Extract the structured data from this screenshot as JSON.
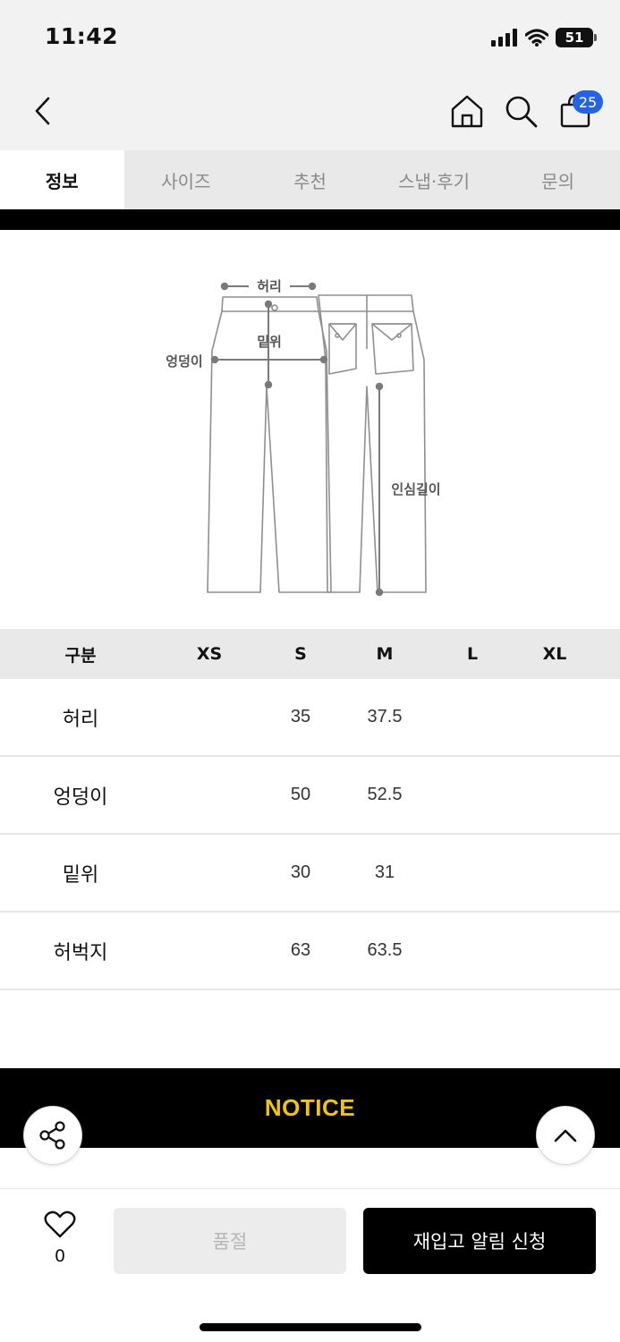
{
  "status_bar": {
    "time": "11:42",
    "battery": "51"
  },
  "header": {
    "cart_count": "25"
  },
  "tabs": [
    {
      "label": "정보",
      "active": true
    },
    {
      "label": "사이즈",
      "active": false
    },
    {
      "label": "추천",
      "active": false
    },
    {
      "label": "스냅·후기",
      "active": false
    },
    {
      "label": "문의",
      "active": false
    }
  ],
  "diagram": {
    "waist": "허리",
    "rise": "밑위",
    "hip": "엉덩이",
    "inseam": "인심길이"
  },
  "size_table": {
    "headers": [
      "구분",
      "XS",
      "S",
      "M",
      "L",
      "XL"
    ],
    "rows": [
      {
        "label": "허리",
        "values": [
          "",
          "35",
          "37.5",
          "",
          ""
        ]
      },
      {
        "label": "엉덩이",
        "values": [
          "",
          "50",
          "52.5",
          "",
          ""
        ]
      },
      {
        "label": "밑위",
        "values": [
          "",
          "30",
          "31",
          "",
          ""
        ]
      },
      {
        "label": "허벅지",
        "values": [
          "",
          "63",
          "63.5",
          "",
          ""
        ]
      }
    ]
  },
  "notice": {
    "title": "NOTICE",
    "color": "#f2c40f"
  },
  "bottom_bar": {
    "like_count": "0",
    "soldout_label": "품절",
    "restock_label": "재입고 알림 신청"
  },
  "colors": {
    "badge": "#2563e6",
    "tab_bg": "#e9e9e9",
    "bar_bg": "#f2f2f2"
  }
}
